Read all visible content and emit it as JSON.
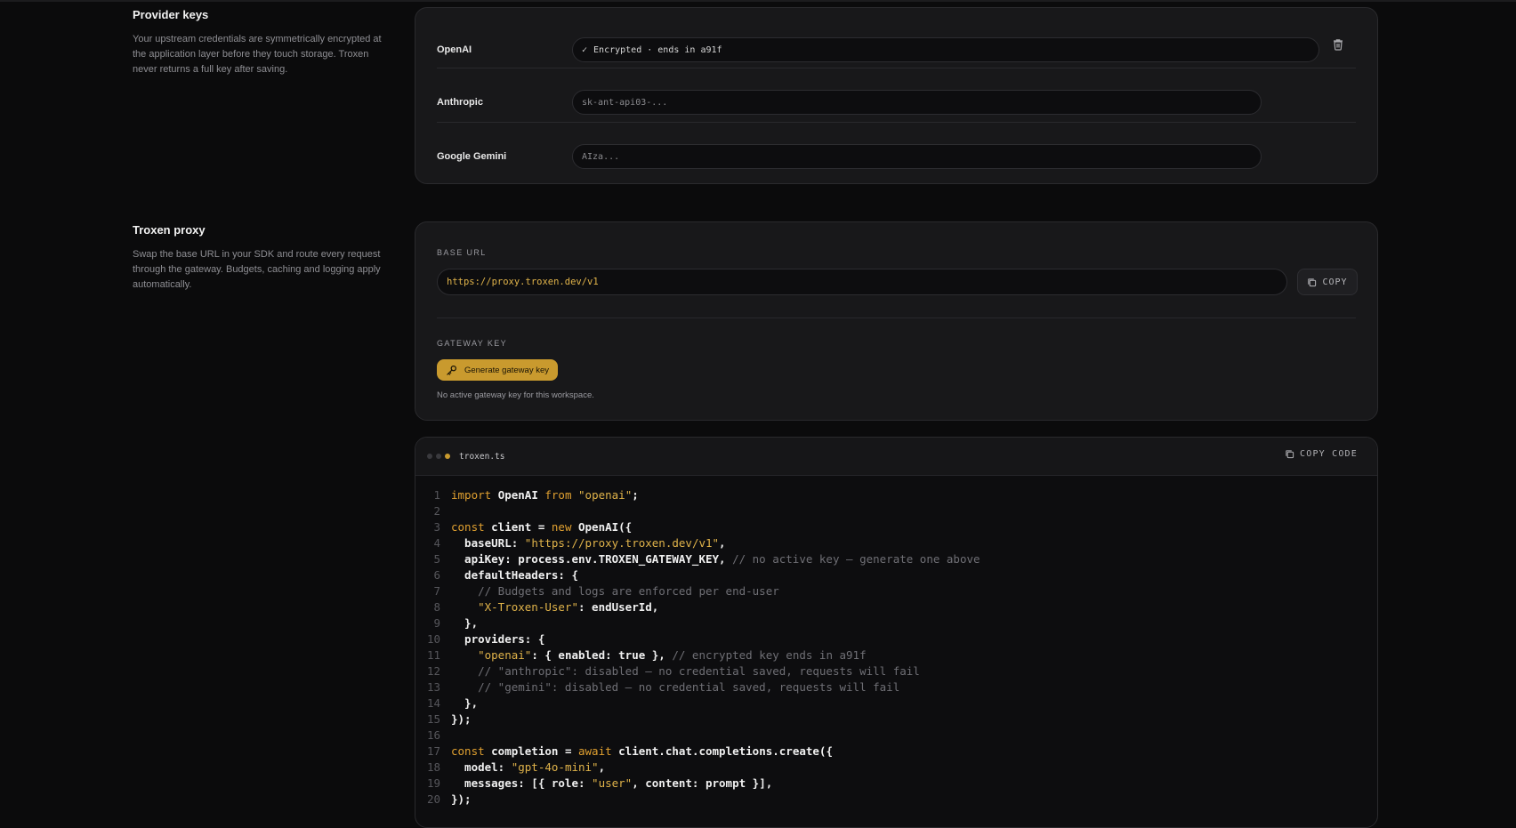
{
  "provider_keys": {
    "title": "Provider keys",
    "description": "Your upstream credentials are symmetrically encrypted at the application layer before they touch storage. Troxen never returns a full key after saving.",
    "providers": [
      {
        "label": "OpenAI",
        "status": "Encrypted · ends in a91f",
        "placeholder": ""
      },
      {
        "label": "Anthropic",
        "status": "",
        "placeholder": "sk-ant-api03-..."
      },
      {
        "label": "Google Gemini",
        "status": "",
        "placeholder": "AIza..."
      }
    ]
  },
  "proxy": {
    "title": "Troxen proxy",
    "description": "Swap the base URL in your SDK and route every request through the gateway. Budgets, caching and logging apply automatically.",
    "base_url_label": "BASE URL",
    "base_url": "https://proxy.troxen.dev/v1",
    "copy_label": "COPY",
    "gateway_key_label": "GATEWAY KEY",
    "generate_label": "Generate gateway key",
    "no_key_hint": "No active gateway key for this workspace."
  },
  "code": {
    "filename": "troxen.ts",
    "copy_label": "COPY CODE",
    "dot_colors": [
      "#3a3a3e",
      "#3a3a3e",
      "#c99a2e"
    ],
    "lines": [
      [
        [
          "kw",
          "import "
        ],
        [
          "p",
          "OpenAI "
        ],
        [
          "kw",
          "from "
        ],
        [
          "str",
          "\"openai\""
        ],
        [
          "p",
          ";"
        ]
      ],
      [],
      [
        [
          "kw",
          "const "
        ],
        [
          "p",
          "client = "
        ],
        [
          "kw",
          "new "
        ],
        [
          "p",
          "OpenAI({"
        ]
      ],
      [
        [
          "p",
          "  baseURL: "
        ],
        [
          "str",
          "\"https://proxy.troxen.dev/v1\""
        ],
        [
          "p",
          ","
        ]
      ],
      [
        [
          "p",
          "  apiKey: process.env.TROXEN_GATEWAY_KEY, "
        ],
        [
          "cm",
          "// no active key — generate one above"
        ]
      ],
      [
        [
          "p",
          "  defaultHeaders: {"
        ]
      ],
      [
        [
          "cm",
          "    // Budgets and logs are enforced per end-user"
        ]
      ],
      [
        [
          "str",
          "    \"X-Troxen-User\""
        ],
        [
          "p",
          ": endUserId,"
        ]
      ],
      [
        [
          "p",
          "  },"
        ]
      ],
      [
        [
          "p",
          "  providers: {"
        ]
      ],
      [
        [
          "str",
          "    \"openai\""
        ],
        [
          "p",
          ": { enabled: true }, "
        ],
        [
          "cm",
          "// encrypted key ends in a91f"
        ]
      ],
      [
        [
          "cm",
          "    // \"anthropic\": disabled — no credential saved, requests will fail"
        ]
      ],
      [
        [
          "cm",
          "    // \"gemini\": disabled — no credential saved, requests will fail"
        ]
      ],
      [
        [
          "p",
          "  },"
        ]
      ],
      [
        [
          "p",
          "});"
        ]
      ],
      [],
      [
        [
          "kw",
          "const "
        ],
        [
          "p",
          "completion = "
        ],
        [
          "kw",
          "await "
        ],
        [
          "p",
          "client.chat.completions.create({"
        ]
      ],
      [
        [
          "p",
          "  model: "
        ],
        [
          "str",
          "\"gpt-4o-mini\""
        ],
        [
          "p",
          ","
        ]
      ],
      [
        [
          "p",
          "  messages: [{ role: "
        ],
        [
          "str",
          "\"user\""
        ],
        [
          "p",
          ", content: prompt }],"
        ]
      ],
      [
        [
          "p",
          "});"
        ]
      ]
    ]
  }
}
